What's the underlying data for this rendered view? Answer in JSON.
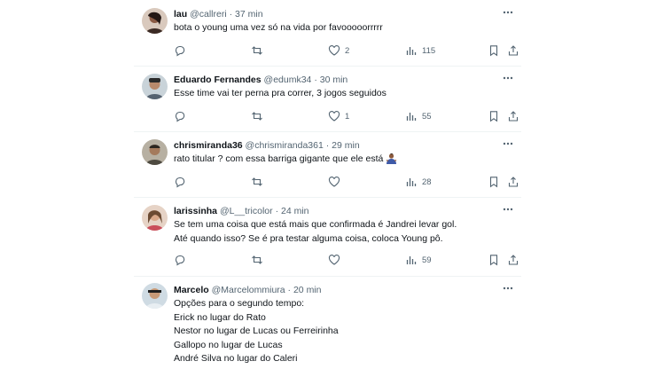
{
  "tweets": [
    {
      "name": "lau",
      "handle": "@callreri",
      "sep": "·",
      "time": "37 min",
      "text": "bota o young uma vez só na vida por favooooorrrrr",
      "likes": "2",
      "views": "115",
      "emoji": ""
    },
    {
      "name": "Eduardo Fernandes",
      "handle": "@edumk34",
      "sep": "·",
      "time": "30 min",
      "text": "Esse time vai ter perna pra correr, 3 jogos seguidos",
      "likes": "1",
      "views": "55",
      "emoji": ""
    },
    {
      "name": "chrismiranda36",
      "handle": "@chrismiranda361",
      "sep": "·",
      "time": "29 min",
      "text": "rato titular ?  com essa barriga gigante que ele está",
      "likes": "",
      "views": "28",
      "emoji": "person-shrugging-emoji"
    },
    {
      "name": "larissinha",
      "handle": "@L__tricolor",
      "sep": "·",
      "time": "24 min",
      "text": "Se tem uma coisa que está mais que confirmada é Jandrei levar gol.\nAté quando isso? Se é pra testar alguma coisa, coloca Young pô.",
      "likes": "",
      "views": "59",
      "emoji": ""
    },
    {
      "name": "Marcelo",
      "handle": "@Marcelommiura",
      "sep": "·",
      "time": "20 min",
      "text": "Opções para o segundo tempo:\nErick no lugar do Rato\nNestor no lugar de Lucas ou Ferreirinha\nGallopo no lugar de Lucas\nAndré Silva no lugar do Caleri",
      "likes": "",
      "views": "",
      "emoji": ""
    }
  ],
  "icons": {
    "more": "more-horizontal-icon",
    "reply": "reply-icon",
    "retweet": "retweet-icon",
    "like": "heart-icon",
    "views": "views-icon",
    "bookmark": "bookmark-icon",
    "share": "share-icon"
  },
  "colors": {
    "text": "#0f1419",
    "muted": "#536471",
    "divider": "#eff3f4"
  }
}
